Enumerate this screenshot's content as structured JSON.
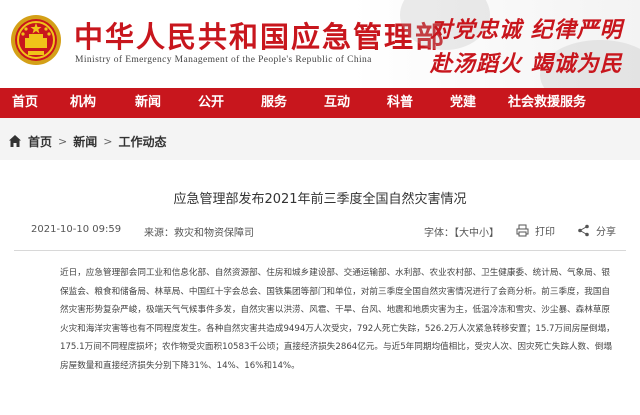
{
  "header": {
    "title_cn": "中华人民共和国应急管理部",
    "title_en": "Ministry of Emergency Management of the People's Republic of China",
    "slogan_line1": "对党忠诚 纪律严明",
    "slogan_line2": "赴汤蹈火 竭诚为民",
    "emblem_icon": "national-emblem-icon"
  },
  "nav": {
    "items": [
      "首页",
      "机构",
      "新闻",
      "公开",
      "服务",
      "互动",
      "科普",
      "党建",
      "社会救援服务"
    ]
  },
  "breadcrumb": {
    "home_icon": "home-icon",
    "items": [
      "首页",
      "新闻",
      "工作动态"
    ],
    "separator": ">"
  },
  "article": {
    "title": "应急管理部发布2021年前三季度全国自然灾害情况",
    "date": "2021-10-10 09:59",
    "source": "来源：救灾和物资保障司",
    "font_size_label": "字体：【大中小】",
    "print_label": "打印",
    "share_label": "分享",
    "body": "近日，应急管理部会同工业和信息化部、自然资源部、住房和城乡建设部、交通运输部、水利部、农业农村部、卫生健康委、统计局、气象局、银保监会、粮食和储备局、林草局、中国红十字会总会、国铁集团等部门和单位，对前三季度全国自然灾害情况进行了会商分析。前三季度，我国自然灾害形势复杂严峻，极端天气气候事件多发，自然灾害以洪涝、风雹、干旱、台风、地震和地质灾害为主，低温冷冻和雪灾、沙尘暴、森林草原火灾和海洋灾害等也有不同程度发生。各种自然灾害共造成9494万人次受灾，792人死亡失踪，526.2万人次紧急转移安置；15.7万间房屋倒塌，175.1万间不同程度损坏；农作物受灾面积10583千公顷；直接经济损失2864亿元。与近5年同期均值相比，受灾人次、因灾死亡失踪人数、倒塌房屋数量和直接经济损失分别下降31%、14%、16%和14%。"
  },
  "colors": {
    "brand_red": "#c8161d",
    "page_bg": "#f4f4f4",
    "content_bg": "#ffffff"
  }
}
